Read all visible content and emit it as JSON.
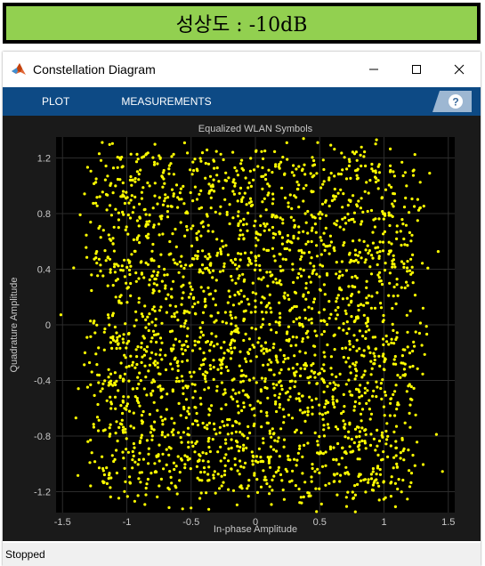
{
  "caption": {
    "text": "성상도 : -10dB"
  },
  "window": {
    "title": "Constellation Diagram",
    "app_icon": "matlab-logo-icon",
    "controls": {
      "minimize": "—",
      "maximize": "☐",
      "close": "✕"
    }
  },
  "toolstrip": {
    "tabs": [
      {
        "label": "PLOT"
      },
      {
        "label": "MEASUREMENTS"
      }
    ],
    "help_icon": "help-icon",
    "colors": {
      "background": "#0d4a85",
      "text": "#ffffff"
    }
  },
  "status": {
    "text": "Stopped"
  },
  "chart_data": {
    "type": "scatter",
    "title": "Equalized WLAN Symbols",
    "xlabel": "In-phase Amplitude",
    "ylabel": "Quadrature Amplitude",
    "xlim": [
      -1.55,
      1.55
    ],
    "ylim": [
      -1.35,
      1.35
    ],
    "xticks": [
      -1.5,
      -1,
      -0.5,
      0,
      0.5,
      1,
      1.5
    ],
    "xtick_labels": [
      "-1.5",
      "-1",
      "-0.5",
      "0",
      "0.5",
      "1",
      "1.5"
    ],
    "yticks": [
      1.2,
      0.8,
      0.4,
      0,
      -0.4,
      -0.8,
      -1.2
    ],
    "ytick_labels": [
      "1.2",
      "0.8",
      "0.4",
      "0",
      "-0.4",
      "-0.8",
      "-1.2"
    ],
    "grid": true,
    "marker_color": "#ffff00",
    "background": "#000000",
    "figure_background": "#1a1a1a",
    "constellation_levels": [
      -1.08,
      -0.77,
      -0.46,
      -0.15,
      0.15,
      0.46,
      0.77,
      1.08
    ],
    "noise_sigma": 0.13,
    "num_points": 2600
  }
}
